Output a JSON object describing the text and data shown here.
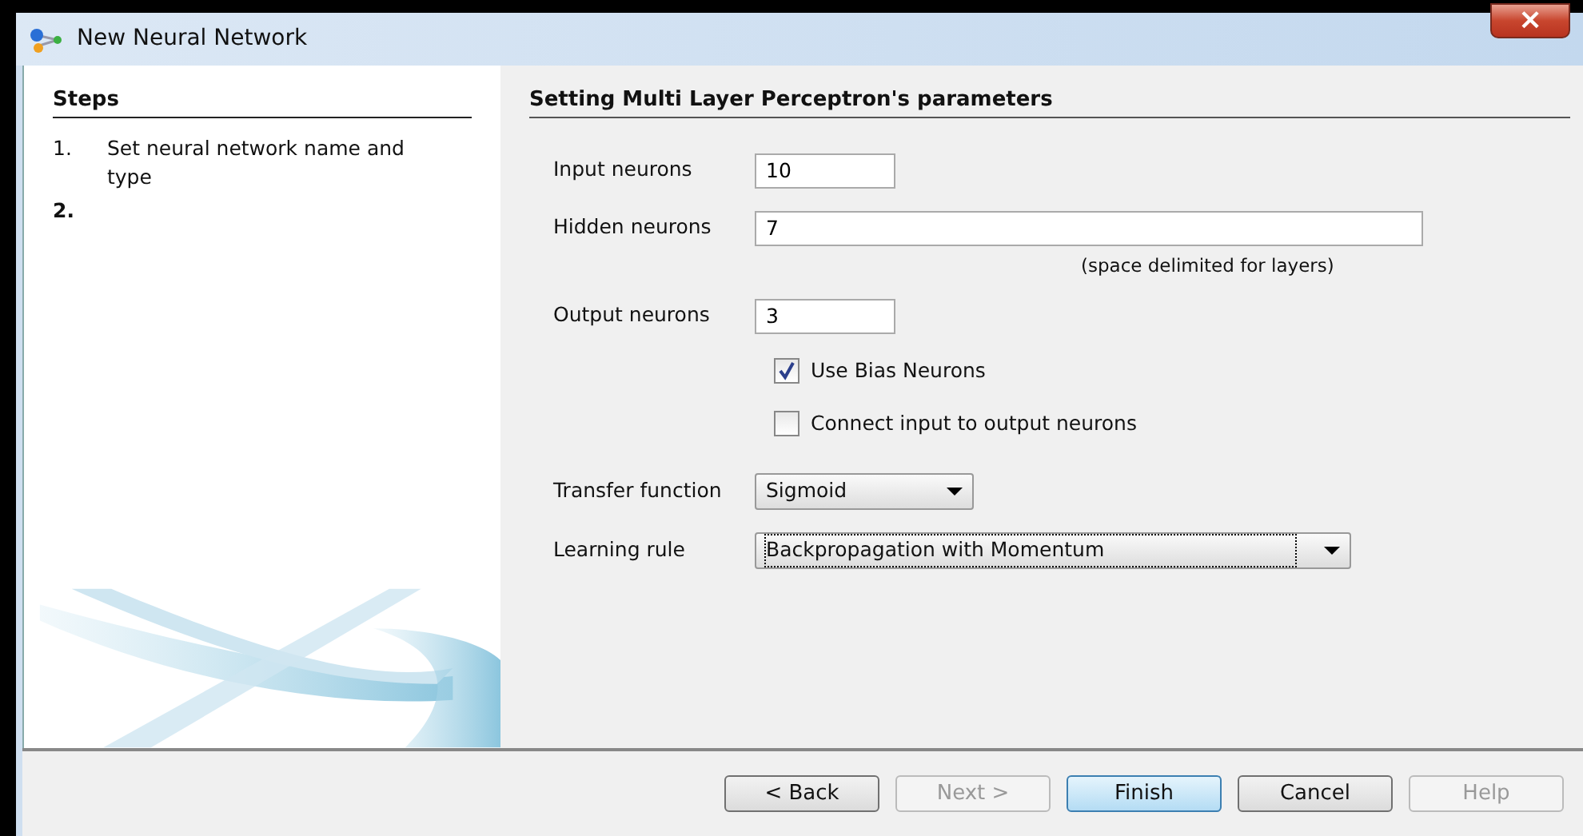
{
  "window": {
    "title": "New Neural Network",
    "close": "×"
  },
  "steps": {
    "title": "Steps",
    "items": [
      {
        "number": "1.",
        "label": "Set neural network name and type",
        "selected": false
      },
      {
        "number": "2.",
        "selected": true
      }
    ]
  },
  "panel": {
    "title": "Setting Multi Layer Perceptron's parameters",
    "rows": [
      {
        "kind": "field",
        "label": "Input neurons",
        "value": "10"
      },
      {
        "kind": "widefield",
        "label": "Hidden neurons",
        "value": "7",
        "hint": "(space delimited for layers)"
      },
      {
        "kind": "field",
        "label": "Output neurons",
        "value": "3"
      },
      {
        "kind": "checkbox",
        "label": "Use Bias Neurons",
        "checked": true
      },
      {
        "kind": "checkbox",
        "label": "Connect input to output neurons",
        "checked": false
      },
      {
        "kind": "dropdown",
        "label": "Transfer function",
        "value": "Sigmoid",
        "focused": false
      },
      {
        "kind": "widedropdown",
        "label": "Learning rule",
        "value": "Backpropagation with Momentum",
        "focused": true
      }
    ]
  },
  "buttons": [
    {
      "label": "< Back",
      "disabled": false,
      "default": false
    },
    {
      "label": "Next >",
      "disabled": true,
      "default": false
    },
    {
      "label": "Finish",
      "disabled": false,
      "default": true
    },
    {
      "label": "Cancel",
      "disabled": false,
      "default": false
    },
    {
      "label": "Help",
      "disabled": true,
      "default": false
    }
  ]
}
